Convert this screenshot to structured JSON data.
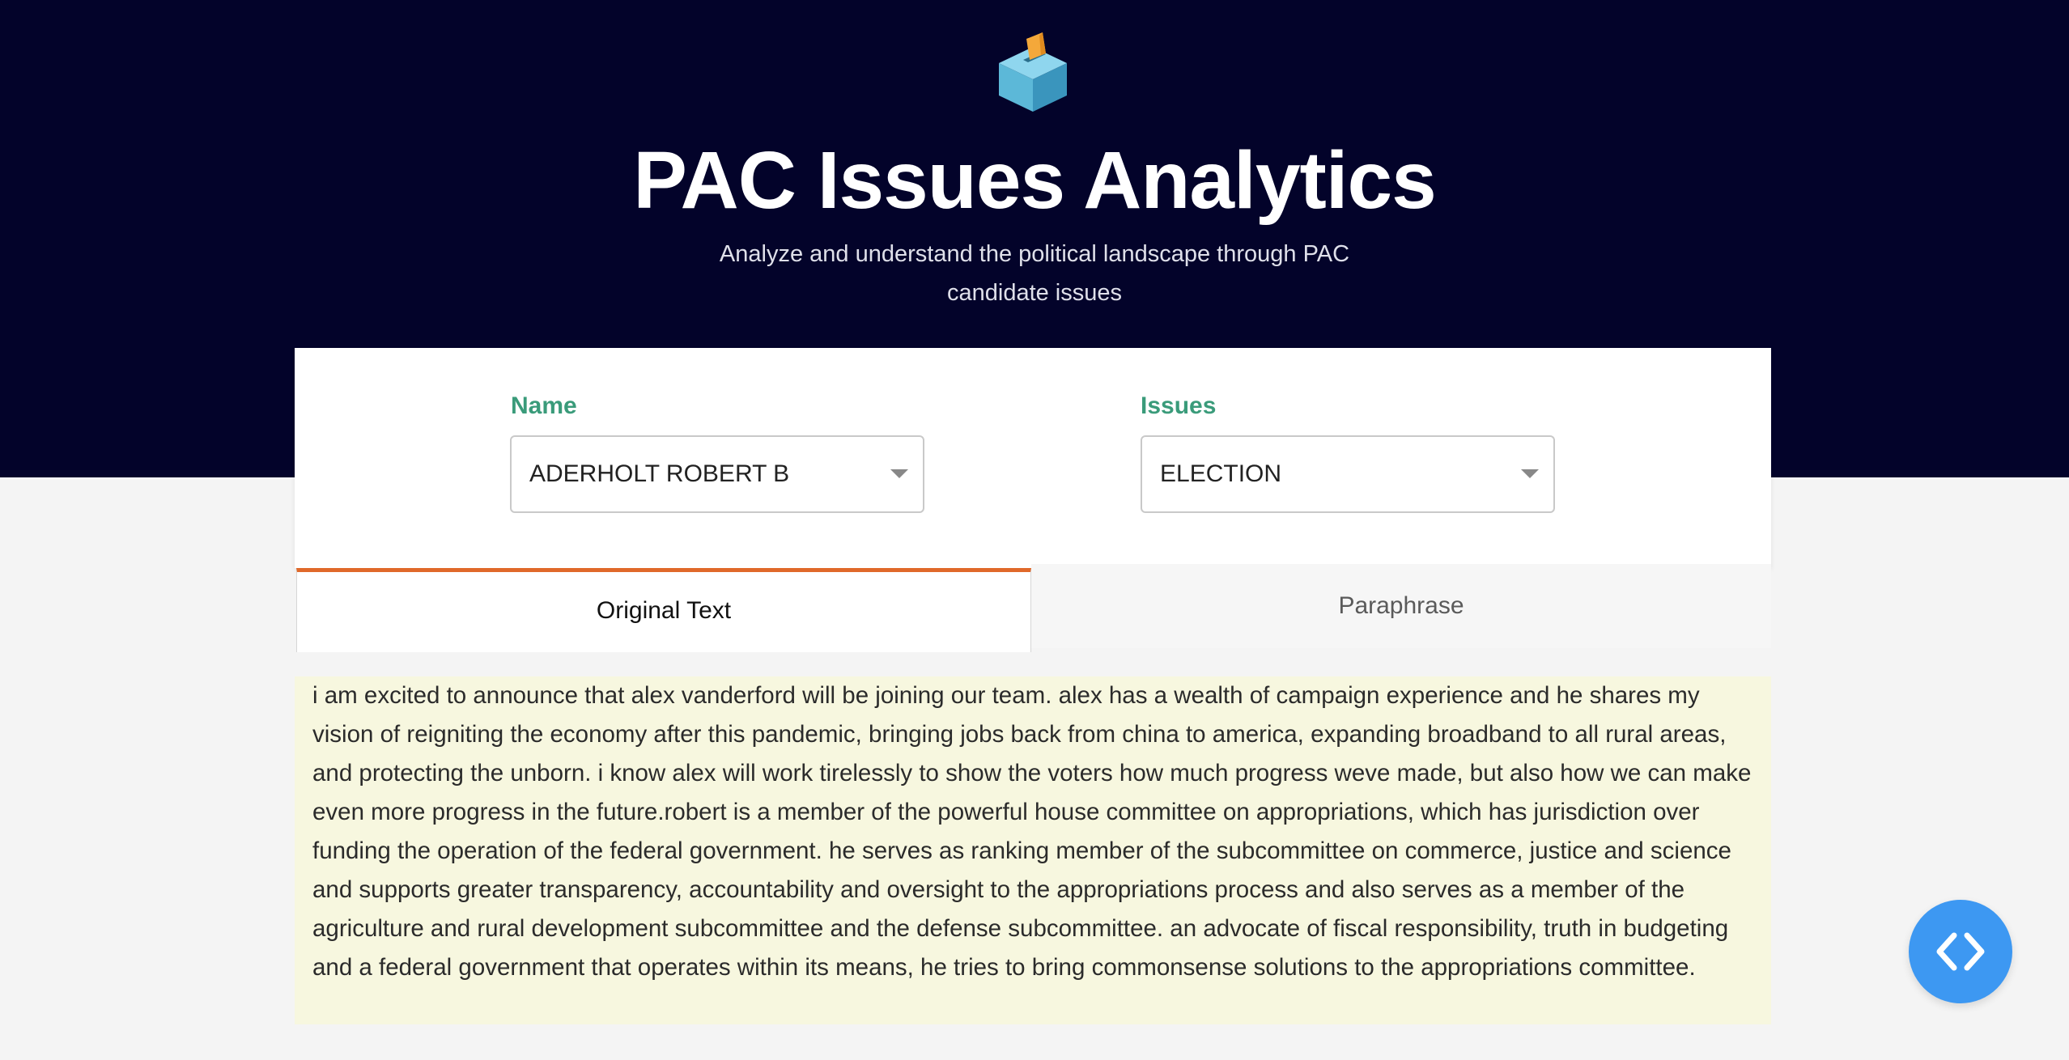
{
  "header": {
    "logo_icon": "ballot-box-icon",
    "title": "PAC Issues Analytics",
    "subtitle": "Analyze and understand the political landscape through PAC candidate issues"
  },
  "filters": {
    "name": {
      "label": "Name",
      "value": "ADERHOLT ROBERT B"
    },
    "issues": {
      "label": "Issues",
      "value": "ELECTION"
    }
  },
  "tabs": [
    {
      "label": "Original Text",
      "active": true
    },
    {
      "label": "Paraphrase",
      "active": false
    }
  ],
  "content": {
    "text": "i am excited to announce that alex vanderford will be joining our team. alex has a wealth of campaign experience and he shares my vision of reigniting the economy after this pandemic, bringing jobs back from china to america, expanding broadband to all rural areas, and protecting the unborn. i know alex will work tirelessly to show the voters how much progress weve made, but also how we can make even more progress in the future.robert is a member of the powerful house committee on appropriations, which has jurisdiction over funding the operation of the federal government. he serves as ranking member of the subcommittee on commerce, justice and science and supports greater transparency, accountability and oversight to the appropriations process and also serves as a member of the agriculture and rural development subcommittee and the defense subcommittee. an advocate of fiscal responsibility, truth in budgeting and a federal government that operates within its means, he tries to bring commonsense solutions to the appropriations committee."
  },
  "floating_button": {
    "icon": "code-icon"
  },
  "colors": {
    "hero_bg": "#03032a",
    "label_green": "#3a9b7a",
    "tab_accent": "#e0692a",
    "content_bg": "#f7f7df",
    "fab_blue": "#3d98f2"
  }
}
